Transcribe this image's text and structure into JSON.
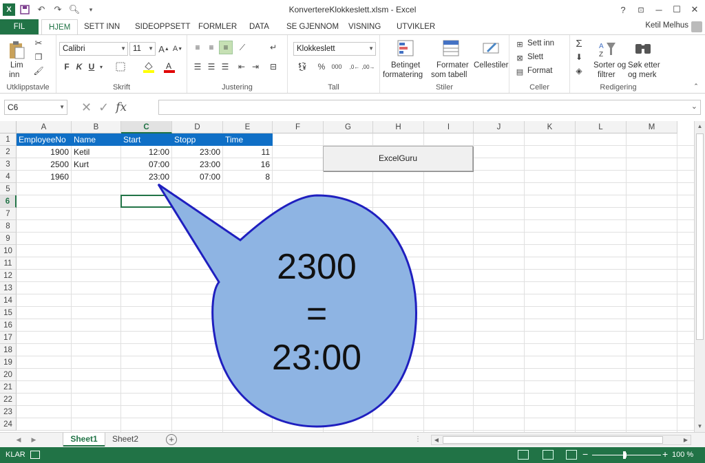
{
  "app": {
    "title": "KonvertereKlokkeslett.xlsm - Excel",
    "user": "Ketil Melhus"
  },
  "window": {
    "help": "?",
    "minimize": "─",
    "maximize": "☐",
    "close": "✕"
  },
  "tabs": [
    "FIL",
    "HJEM",
    "SETT INN",
    "SIDEOPPSETT",
    "FORMLER",
    "DATA",
    "SE GJENNOM",
    "VISNING",
    "UTVIKLER"
  ],
  "ribbon": {
    "clipboard": {
      "label": "Utklippstavle",
      "paste": "Lim",
      "paste2": "inn"
    },
    "font": {
      "label": "Skrift",
      "name": "Calibri",
      "size": "11",
      "bold": "F",
      "italic": "K",
      "underline": "U"
    },
    "alignment": {
      "label": "Justering"
    },
    "number": {
      "label": "Tall",
      "format": "Klokkeslett",
      "percent": "%",
      "thousands": "000"
    },
    "styles": {
      "label": "Stiler",
      "cond1": "Betinget",
      "cond2": "formatering",
      "table1": "Formater",
      "table2": "som tabell",
      "cell": "Cellestiler"
    },
    "cells": {
      "label": "Celler",
      "insert": "Sett inn",
      "delete": "Slett",
      "format": "Format"
    },
    "editing": {
      "label": "Redigering",
      "sort1": "Sorter og",
      "sort2": "filtrer",
      "find1": "Søk etter",
      "find2": "og merk"
    }
  },
  "formula_bar": {
    "name_box": "C6",
    "fx": "fx",
    "value": ""
  },
  "columns": [
    "A",
    "B",
    "C",
    "D",
    "E",
    "F",
    "G",
    "H",
    "I",
    "J",
    "K",
    "L",
    "M"
  ],
  "rows": [
    "1",
    "2",
    "3",
    "4",
    "5",
    "6",
    "7",
    "8",
    "9",
    "10",
    "11",
    "12",
    "13",
    "14",
    "15",
    "16",
    "17",
    "18",
    "19",
    "20",
    "21",
    "22",
    "23",
    "24"
  ],
  "table": {
    "headers": [
      "EmployeeNo",
      "Name",
      "Start",
      "Stopp",
      "Time"
    ],
    "rows": [
      [
        "1900",
        "Ketil",
        "12:00",
        "23:00",
        "11"
      ],
      [
        "2500",
        "Kurt",
        "07:00",
        "23:00",
        "16"
      ],
      [
        "1960",
        "",
        "23:00",
        "07:00",
        "8"
      ]
    ]
  },
  "button": {
    "label": "ExcelGuru"
  },
  "callout": {
    "line1": "2300",
    "line2": "=",
    "line3": "23:00",
    "fill": "#8eb4e3",
    "stroke": "#1f1fbf"
  },
  "sheets": [
    "Sheet1",
    "Sheet2"
  ],
  "status": {
    "mode": "KLAR",
    "zoom": "100 %"
  },
  "colors": {
    "accent": "#217346",
    "header_fill": "#0f6fc6"
  }
}
